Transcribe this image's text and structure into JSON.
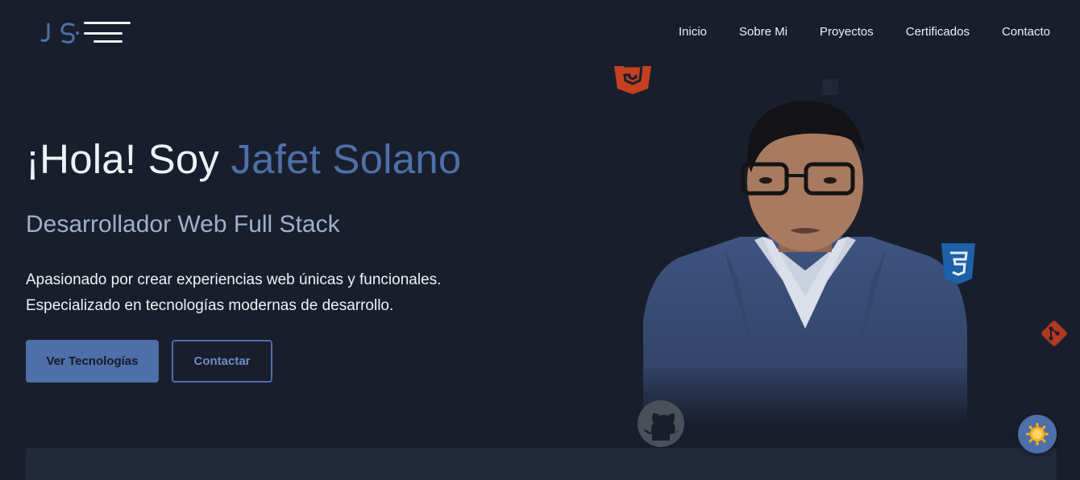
{
  "nav": {
    "logo_text": "JS",
    "links": [
      "Inicio",
      "Sobre Mi",
      "Proyectos",
      "Certificados",
      "Contacto"
    ]
  },
  "hero": {
    "greeting": "¡Hola! Soy",
    "name": "Jafet Solano",
    "subtitle": "Desarrollador Web Full Stack",
    "description_line1": "Apasionado por crear experiencias web únicas y funcionales.",
    "description_line2": "Especializado en tecnologías modernas de desarrollo.",
    "primary_button": "Ver Tecnologías",
    "secondary_button": "Contactar"
  },
  "floating_icons": [
    "html5-icon",
    "css3-icon",
    "git-icon",
    "github-icon"
  ],
  "theme_toggle_icon": "sun-icon",
  "colors": {
    "background": "#191e2c",
    "accent": "#4e6fa8",
    "subtitle": "#9fb0cc",
    "html5": "#c5401f",
    "css3": "#1d61a8",
    "git": "#b2381f",
    "sun": "#f7b21c"
  }
}
